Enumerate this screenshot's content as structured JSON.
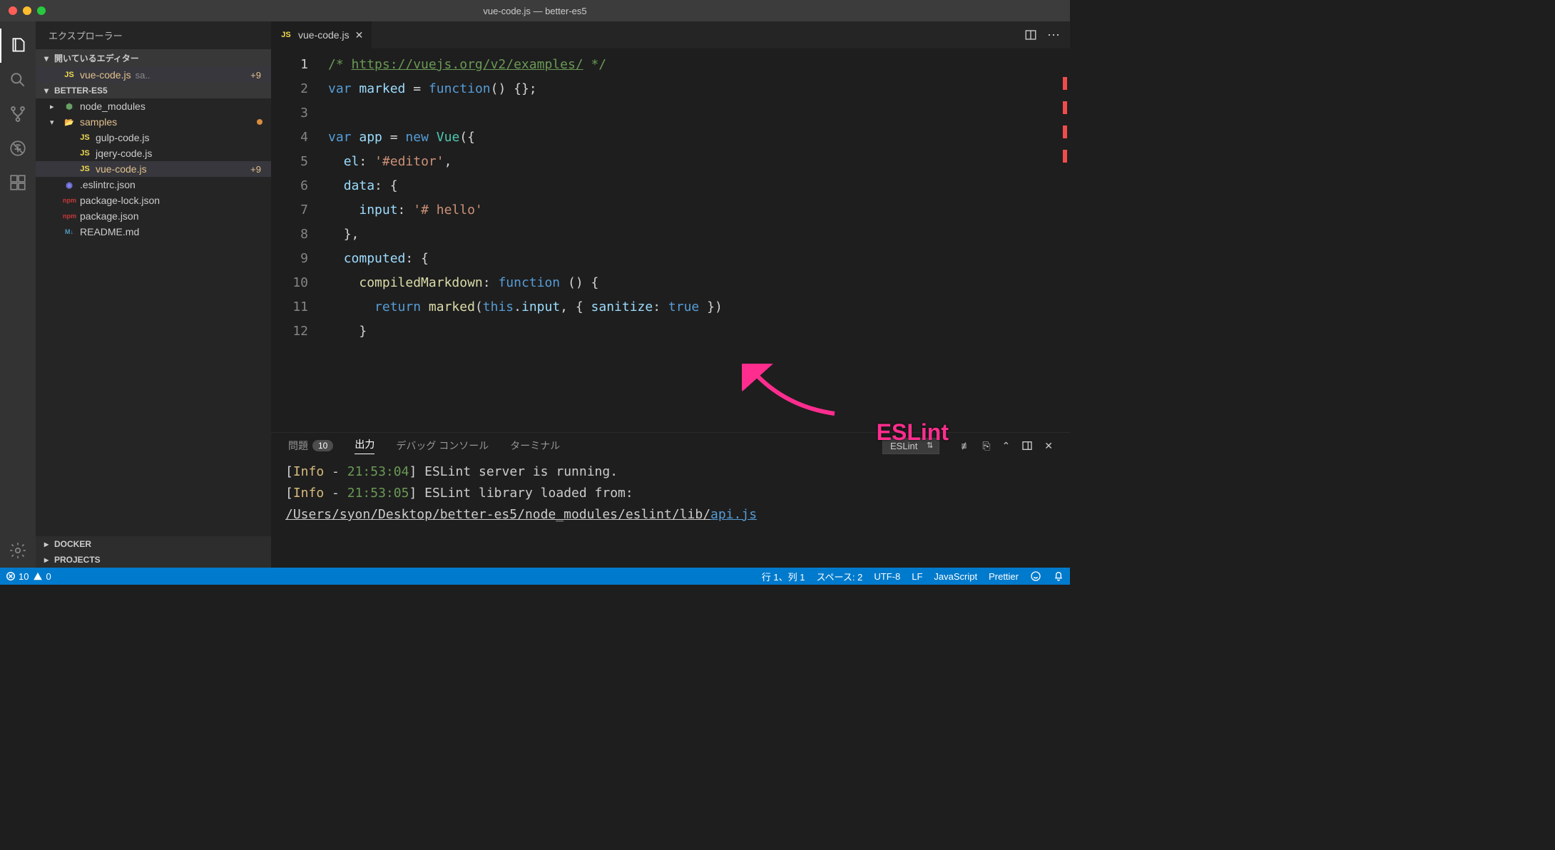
{
  "window": {
    "title": "vue-code.js — better-es5"
  },
  "activity": {
    "items": [
      "explorer",
      "search",
      "scm",
      "debug",
      "extensions"
    ],
    "bottom": "gear"
  },
  "sidebar": {
    "title": "エクスプローラー",
    "open_editors": {
      "label": "開いているエディター",
      "file": {
        "name": "vue-code.js",
        "short": "sa..",
        "badge": "+9"
      }
    },
    "workspace": {
      "label": "BETTER-ES5",
      "tree": [
        {
          "type": "folder",
          "name": "node_modules",
          "open": false
        },
        {
          "type": "folder",
          "name": "samples",
          "open": true,
          "modified": true,
          "children": [
            {
              "type": "file",
              "icon": "js",
              "name": "gulp-code.js"
            },
            {
              "type": "file",
              "icon": "js",
              "name": "jqery-code.js"
            },
            {
              "type": "file",
              "icon": "js",
              "name": "vue-code.js",
              "active": true,
              "badge": "+9"
            }
          ]
        },
        {
          "type": "file",
          "icon": "eslint",
          "name": ".eslintrc.json"
        },
        {
          "type": "file",
          "icon": "npm",
          "name": "package-lock.json"
        },
        {
          "type": "file",
          "icon": "npm",
          "name": "package.json"
        },
        {
          "type": "file",
          "icon": "md",
          "name": "README.md"
        }
      ]
    },
    "bottom_sections": [
      "DOCKER",
      "PROJECTS"
    ]
  },
  "editor": {
    "tab": {
      "name": "vue-code.js"
    },
    "lines": 12,
    "code": {
      "url": "https://vuejs.org/v2/examples/",
      "l2": {
        "kw": "var",
        "name": "marked",
        "fn": "function"
      },
      "l4": {
        "kw": "var",
        "name": "app",
        "new": "new",
        "cls": "Vue"
      },
      "l5": {
        "prop": "el",
        "str": "'#editor'"
      },
      "l6": {
        "prop": "data"
      },
      "l7": {
        "prop": "input",
        "str": "'# hello'"
      },
      "l9": {
        "prop": "computed"
      },
      "l10": {
        "prop": "compiledMarkdown",
        "fn": "function"
      },
      "l11": {
        "ret": "return",
        "fn": "marked",
        "this": "this",
        "prop": "input",
        "opt": "sanitize",
        "bool": "true"
      }
    }
  },
  "panel": {
    "tabs": {
      "problems": {
        "label": "問題",
        "count": "10"
      },
      "output": "出力",
      "debug": "デバッグ コンソール",
      "terminal": "ターミナル"
    },
    "channel": "ESLint",
    "log": {
      "l1": {
        "level": "Info",
        "time": "21:53:04",
        "msg": "ESLint server is running."
      },
      "l2": {
        "level": "Info",
        "time": "21:53:05",
        "msg": "ESLint library loaded from:"
      },
      "l3": {
        "path": "/Users/syon/Desktop/better-es5/node_modules/eslint/lib/",
        "file": "api.js"
      }
    }
  },
  "annotation": "ESLint",
  "status": {
    "errors": "10",
    "warnings": "0",
    "cursor": "行 1、列 1",
    "spaces": "スペース: 2",
    "encoding": "UTF-8",
    "eol": "LF",
    "lang": "JavaScript",
    "prettier": "Prettier"
  }
}
